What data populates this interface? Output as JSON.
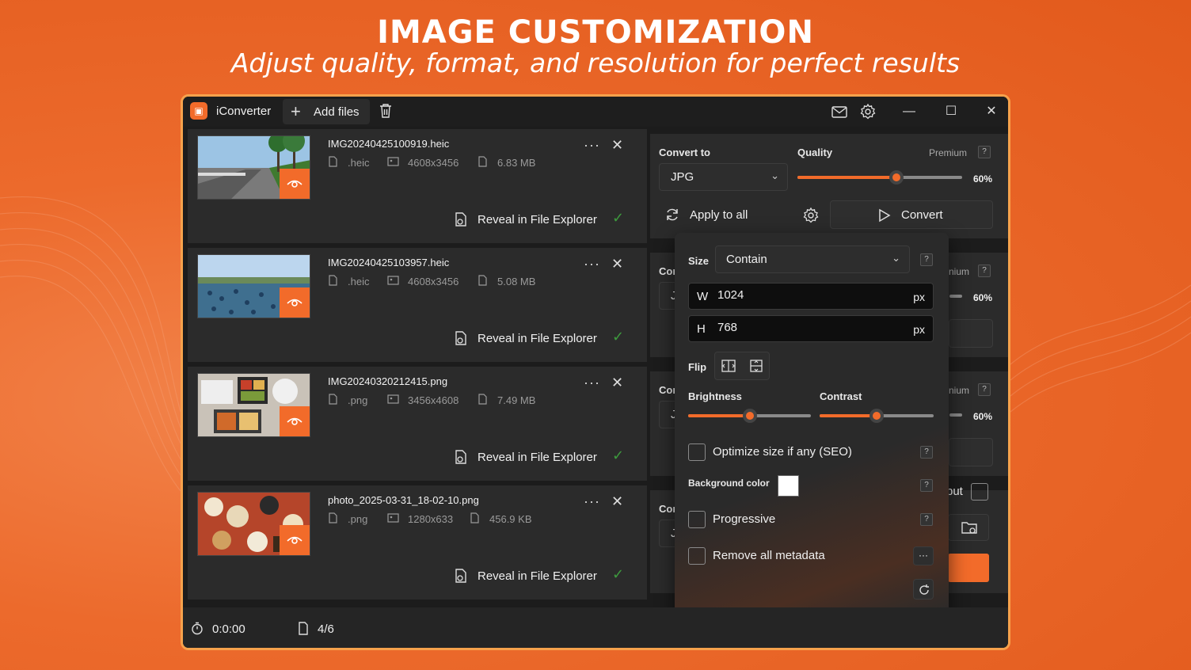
{
  "promo": {
    "headline": "IMAGE CUSTOMIZATION",
    "subheadline": "Adjust quality, format, and resolution for perfect results"
  },
  "titlebar": {
    "app_name": "iConverter",
    "add_files_label": "Add files"
  },
  "files": [
    {
      "name": "IMG20240425100919.heic",
      "ext": ".heic",
      "dims": "4608x3456",
      "size": "6.83 MB",
      "reveal": "Reveal in File Explorer"
    },
    {
      "name": "IMG20240425103957.heic",
      "ext": ".heic",
      "dims": "4608x3456",
      "size": "5.08 MB",
      "reveal": "Reveal in File Explorer"
    },
    {
      "name": "IMG20240320212415.png",
      "ext": ".png",
      "dims": "3456x4608",
      "size": "7.49 MB",
      "reveal": "Reveal in File Explorer"
    },
    {
      "name": "photo_2025-03-31_18-02-10.png",
      "ext": ".png",
      "dims": "1280x633",
      "size": "456.9 KB",
      "reveal": "Reveal in File Explorer"
    }
  ],
  "settings": {
    "convert_to_label": "Convert to",
    "format": "JPG",
    "quality_label": "Quality",
    "premium_label": "Premium",
    "quality_value": 0.6,
    "quality_text": "60%",
    "apply_to_all": "Apply to all",
    "convert_label": "Convert",
    "partial_convert_label": "Cor",
    "partial_format": "J",
    "partial_premium": "nium",
    "partial_output": "put"
  },
  "popup": {
    "size_label": "Size",
    "size_mode": "Contain",
    "width_prefix": "W",
    "width_value": "1024",
    "height_prefix": "H",
    "height_value": "768",
    "unit": "px",
    "flip_label": "Flip",
    "brightness_label": "Brightness",
    "brightness_value": 0.5,
    "contrast_label": "Contrast",
    "contrast_value": 0.5,
    "optimize_label": "Optimize size if any (SEO)",
    "background_label": "Background color",
    "background_color": "#ffffff",
    "progressive_label": "Progressive",
    "metadata_label": "Remove all metadata",
    "help_mark": "?",
    "more_mark": "···"
  },
  "status": {
    "elapsed": "0:0:00",
    "count": "4/6"
  },
  "colors": {
    "accent": "#f26b2a",
    "background": "#1c1c1c",
    "card": "#2b2b2b",
    "success": "#3d9a3d"
  }
}
